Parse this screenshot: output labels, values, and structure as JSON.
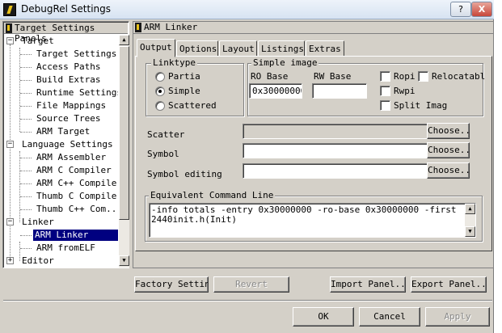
{
  "window": {
    "title": "DebugRel Settings",
    "help_label": "?",
    "close_label": "X"
  },
  "tree": {
    "header": "Target Settings Panels",
    "items": [
      {
        "label": "Target",
        "toggle": "−"
      },
      {
        "label": "Target Settings"
      },
      {
        "label": "Access Paths"
      },
      {
        "label": "Build Extras"
      },
      {
        "label": "Runtime Settings"
      },
      {
        "label": "File Mappings"
      },
      {
        "label": "Source Trees"
      },
      {
        "label": "ARM Target"
      },
      {
        "label": "Language Settings",
        "toggle": "−"
      },
      {
        "label": "ARM Assembler"
      },
      {
        "label": "ARM C Compiler"
      },
      {
        "label": "ARM C++ Compiler"
      },
      {
        "label": "Thumb C Compiler"
      },
      {
        "label": "Thumb C++ Com..."
      },
      {
        "label": "Linker",
        "toggle": "−"
      },
      {
        "label": "ARM Linker"
      },
      {
        "label": "ARM fromELF"
      },
      {
        "label": "Editor",
        "toggle": "+"
      }
    ]
  },
  "panel": {
    "title": "ARM Linker",
    "tabs": [
      "Output",
      "Options",
      "Layout",
      "Listings",
      "Extras"
    ],
    "linktype": {
      "title": "Linktype",
      "options": [
        "Partia",
        "Simple",
        "Scattered"
      ],
      "selected": "Simple"
    },
    "simple_image": {
      "title": "Simple image",
      "ro_base_label": "RO Base",
      "rw_base_label": "RW Base",
      "ro_base_value": "0x30000000",
      "rw_base_value": "",
      "checks": [
        "Ropi",
        "Relocatabl",
        "Rwpi",
        "Split Imag"
      ]
    },
    "scatter_label": "Scatter",
    "symbol_label": "Symbol",
    "symbol_editing_label": "Symbol editing",
    "choose_label": "Choose...",
    "equiv_title": "Equivalent Command Line",
    "command_line": "-info totals -entry 0x30000000 -ro-base 0x30000000 -first 2440init.h(Init)"
  },
  "footer": {
    "factory": "Factory Settings",
    "revert": "Revert",
    "import": "Import Panel...",
    "export": "Export Panel...",
    "ok": "OK",
    "cancel": "Cancel",
    "apply": "Apply"
  },
  "icons": [
    "app-icon",
    "header-icon",
    "scroll-up-arrow-icon",
    "scroll-down-arrow-icon"
  ]
}
